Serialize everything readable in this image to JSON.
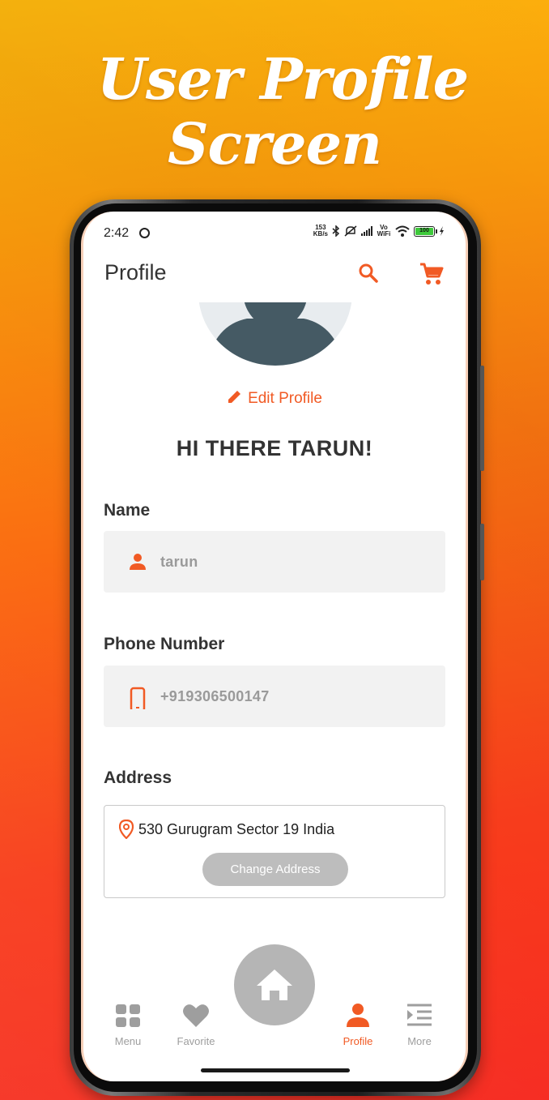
{
  "promo": {
    "title_line1": "User Profile",
    "title_line2": "Screen"
  },
  "status_bar": {
    "time": "2:42",
    "speed_value": "153",
    "speed_unit": "KB/s",
    "network_label": "Vo WiFi",
    "battery": "100"
  },
  "header": {
    "title": "Profile",
    "icons": [
      "search-icon",
      "cart-icon"
    ]
  },
  "profile": {
    "edit_label": "Edit Profile",
    "greeting": "HI THERE TARUN!",
    "name_label": "Name",
    "name_value": "tarun",
    "phone_label": "Phone Number",
    "phone_value": "+919306500147",
    "address_label": "Address",
    "address_value": "530 Gurugram Sector 19 India",
    "change_address_label": "Change Address"
  },
  "bottom_nav": {
    "items": [
      {
        "label": "Menu",
        "icon": "grid-icon"
      },
      {
        "label": "Favorite",
        "icon": "heart-icon"
      },
      {
        "label": "Profile",
        "icon": "person-icon",
        "active": true
      },
      {
        "label": "More",
        "icon": "indent-list-icon"
      }
    ],
    "home_icon": "home-icon"
  },
  "colors": {
    "accent": "#f15a24",
    "inactive": "#9e9e9e",
    "field_bg": "#f2f2f2",
    "home_fab": "#b5b5b5",
    "background_top": "#fcb70d",
    "background_bottom": "#f6291f"
  }
}
